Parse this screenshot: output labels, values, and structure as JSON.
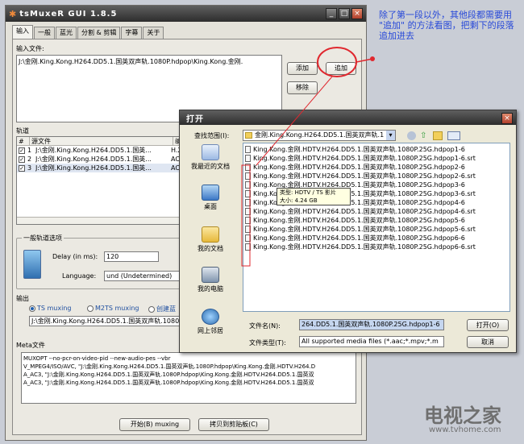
{
  "main_window": {
    "title": "tsMuxeR GUI 1.8.5",
    "tabs": [
      "输入",
      "一般",
      "蓝光",
      "分割 & 剪辑",
      "字幕",
      "关于"
    ],
    "input_files_label": "输入文件:",
    "input_file": "J:\\金刚.King.Kong.H264.DD5.1.国英双声轨.1080P.hdpop\\King.Kong.金刚.",
    "add_button": "添加",
    "append_button": "追加",
    "remove_button": "移除",
    "tracks_label": "轨道",
    "track_columns": [
      "#",
      "源文件",
      "编"
    ],
    "tracks": [
      {
        "num": "1",
        "file": "J:\\金刚.King.Kong.H264.DD5.1.国英...",
        "codec": "H.2"
      },
      {
        "num": "2",
        "file": "J:\\金刚.King.Kong.H264.DD5.1.国英...",
        "codec": "AC"
      },
      {
        "num": "3",
        "file": "J:\\金刚.King.Kong.H264.DD5.1.国英...",
        "codec": "AC"
      }
    ],
    "track_options_label": "一般轨道选项",
    "delay_label": "Delay (in ms):",
    "delay_value": "120",
    "language_label": "Language:",
    "language_value": "und (Undetermined)",
    "output_label": "输出",
    "output_modes": [
      "TS muxing",
      "M2TS muxing",
      "创建蓝"
    ],
    "output_path": "J:\\金刚.King.Kong.H264.DD5.1.国英双声轨.1080P.",
    "meta_label": "Meta文件",
    "meta_lines": [
      "MUXOPT --no-pcr-on-video-pid --new-audio-pes --vbr",
      "V_MPEG4/ISO/AVC, \"J:\\金刚.King.Kong.H264.DD5.1.国英双声轨.1080P.hdpop\\King.Kong.金刚.HDTV.H264.D",
      "A_AC3, \"J:\\金刚.King.Kong.H264.DD5.1.国英双声轨.1080P.hdpop\\King.Kong.金刚.HDTV.H264.DD5.1.国英双",
      "A_AC3, \"J:\\金刚.King.Kong.H264.DD5.1.国英双声轨.1080P.hdpop\\King.Kong.金刚.HDTV.H264.DD5.1.国英双"
    ],
    "start_button": "开始(B) muxing",
    "copy_button": "拷贝到剪贴板(C)"
  },
  "dialog": {
    "title": "打开",
    "lookin_label": "查找范围(I):",
    "lookin_value": "金刚.King.Kong.H264.DD5.1.国英双声轨.1",
    "places": [
      "我最近的文档",
      "桌面",
      "我的文档",
      "我的电脑",
      "网上邻居"
    ],
    "files": [
      "King.Kong.金刚.HDTV.H264.DD5.1.国英双声轨.1080P.25G.hdpop1-6",
      "King.Kong.金刚.HDTV.H264.DD5.1.国英双声轨.1080P.25G.hdpop1-6.srt",
      "King.Kong.金刚.HDTV.H264.DD5.1.国英双声轨.1080P.25G.hdpop2-6",
      "King.Kong.金刚.HDTV.H264.DD5.1.国英双声轨.1080P.25G.hdpop2-6.srt",
      "King.Kong.金刚.HDTV.H264.DD5.1.国英双声轨.1080P.25G.hdpop3-6",
      "King.Kong.金刚.HDTV.H264.DD5.1.国英双声轨.1080P.25G.hdpop3-6.srt",
      "King.Kong.金刚.HDTV.H264.DD5.1.国英双声轨.1080P.25G.hdpop4-6",
      "King.Kong.金刚.HDTV.H264.DD5.1.国英双声轨.1080P.25G.hdpop4-6.srt",
      "King.Kong.金刚.HDTV.H264.DD5.1.国英双声轨.1080P.25G.hdpop5-6",
      "King.Kong.金刚.HDTV.H264.DD5.1.国英双声轨.1080P.25G.hdpop5-6.srt",
      "King.Kong.金刚.HDTV.H264.DD5.1.国英双声轨.1080P.25G.hdpop6-6",
      "King.Kong.金刚.HDTV.H264.DD5.1.国英双声轨.1080P.25G.hdpop6-6.srt"
    ],
    "tooltip_type": "类型: HDTV / TS 影片",
    "tooltip_size": "大小: 4.24 GB",
    "filename_label": "文件名(N):",
    "filename_value": "264.DD5.1.国英双声轨.1080P.25G.hdpop1-6",
    "filetype_label": "文件类型(T):",
    "filetype_value": "All supported media files (*.aac;*.mpv;*.m",
    "open_button": "打开(O)",
    "cancel_button": "取消"
  },
  "annotation": "除了第一段以外，其他段都需要用 \"追加\" 的方法看图，把剩下的段落追加进去",
  "watermark": {
    "brand": "电视之家",
    "url": "www.tvhome.com"
  },
  "colors": {
    "annotation": "#2849d8",
    "highlight_circle": "#e0282f",
    "title_bar": "#3a3a3a"
  }
}
